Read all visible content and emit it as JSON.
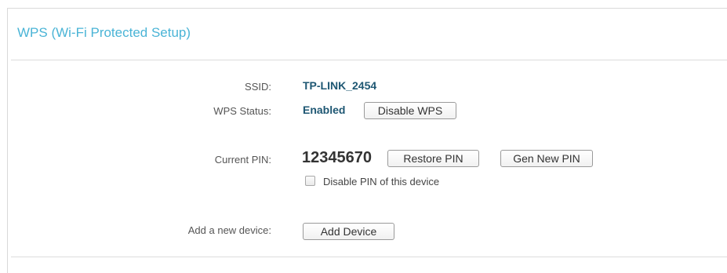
{
  "section": {
    "title": "WPS (Wi-Fi Protected Setup)"
  },
  "ssid": {
    "label": "SSID:",
    "value": "TP-LINK_2454"
  },
  "wps_status": {
    "label": "WPS Status:",
    "value": "Enabled",
    "disable_button": "Disable WPS"
  },
  "current_pin": {
    "label": "Current PIN:",
    "value": "12345670",
    "restore_button": "Restore PIN",
    "gen_button": "Gen New PIN",
    "disable_pin_checkbox_label": "Disable PIN of this device",
    "disable_pin_checked": false
  },
  "add_device": {
    "label": "Add a new device:",
    "button": "Add Device"
  },
  "colors": {
    "title": "#4ab4d6",
    "value": "#1e5773"
  }
}
